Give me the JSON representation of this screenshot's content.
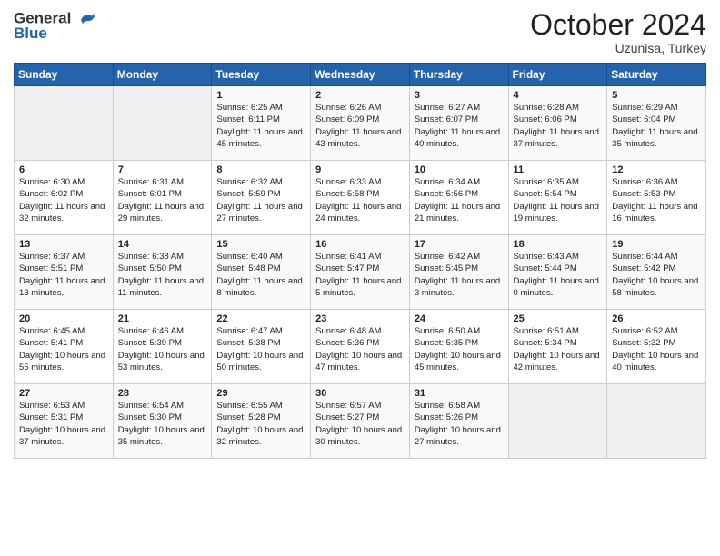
{
  "header": {
    "logo_line1": "General",
    "logo_line2": "Blue",
    "month": "October 2024",
    "location": "Uzunisa, Turkey"
  },
  "weekdays": [
    "Sunday",
    "Monday",
    "Tuesday",
    "Wednesday",
    "Thursday",
    "Friday",
    "Saturday"
  ],
  "weeks": [
    [
      {
        "day": "",
        "info": ""
      },
      {
        "day": "",
        "info": ""
      },
      {
        "day": "1",
        "info": "Sunrise: 6:25 AM\nSunset: 6:11 PM\nDaylight: 11 hours and 45 minutes."
      },
      {
        "day": "2",
        "info": "Sunrise: 6:26 AM\nSunset: 6:09 PM\nDaylight: 11 hours and 43 minutes."
      },
      {
        "day": "3",
        "info": "Sunrise: 6:27 AM\nSunset: 6:07 PM\nDaylight: 11 hours and 40 minutes."
      },
      {
        "day": "4",
        "info": "Sunrise: 6:28 AM\nSunset: 6:06 PM\nDaylight: 11 hours and 37 minutes."
      },
      {
        "day": "5",
        "info": "Sunrise: 6:29 AM\nSunset: 6:04 PM\nDaylight: 11 hours and 35 minutes."
      }
    ],
    [
      {
        "day": "6",
        "info": "Sunrise: 6:30 AM\nSunset: 6:02 PM\nDaylight: 11 hours and 32 minutes."
      },
      {
        "day": "7",
        "info": "Sunrise: 6:31 AM\nSunset: 6:01 PM\nDaylight: 11 hours and 29 minutes."
      },
      {
        "day": "8",
        "info": "Sunrise: 6:32 AM\nSunset: 5:59 PM\nDaylight: 11 hours and 27 minutes."
      },
      {
        "day": "9",
        "info": "Sunrise: 6:33 AM\nSunset: 5:58 PM\nDaylight: 11 hours and 24 minutes."
      },
      {
        "day": "10",
        "info": "Sunrise: 6:34 AM\nSunset: 5:56 PM\nDaylight: 11 hours and 21 minutes."
      },
      {
        "day": "11",
        "info": "Sunrise: 6:35 AM\nSunset: 5:54 PM\nDaylight: 11 hours and 19 minutes."
      },
      {
        "day": "12",
        "info": "Sunrise: 6:36 AM\nSunset: 5:53 PM\nDaylight: 11 hours and 16 minutes."
      }
    ],
    [
      {
        "day": "13",
        "info": "Sunrise: 6:37 AM\nSunset: 5:51 PM\nDaylight: 11 hours and 13 minutes."
      },
      {
        "day": "14",
        "info": "Sunrise: 6:38 AM\nSunset: 5:50 PM\nDaylight: 11 hours and 11 minutes."
      },
      {
        "day": "15",
        "info": "Sunrise: 6:40 AM\nSunset: 5:48 PM\nDaylight: 11 hours and 8 minutes."
      },
      {
        "day": "16",
        "info": "Sunrise: 6:41 AM\nSunset: 5:47 PM\nDaylight: 11 hours and 5 minutes."
      },
      {
        "day": "17",
        "info": "Sunrise: 6:42 AM\nSunset: 5:45 PM\nDaylight: 11 hours and 3 minutes."
      },
      {
        "day": "18",
        "info": "Sunrise: 6:43 AM\nSunset: 5:44 PM\nDaylight: 11 hours and 0 minutes."
      },
      {
        "day": "19",
        "info": "Sunrise: 6:44 AM\nSunset: 5:42 PM\nDaylight: 10 hours and 58 minutes."
      }
    ],
    [
      {
        "day": "20",
        "info": "Sunrise: 6:45 AM\nSunset: 5:41 PM\nDaylight: 10 hours and 55 minutes."
      },
      {
        "day": "21",
        "info": "Sunrise: 6:46 AM\nSunset: 5:39 PM\nDaylight: 10 hours and 53 minutes."
      },
      {
        "day": "22",
        "info": "Sunrise: 6:47 AM\nSunset: 5:38 PM\nDaylight: 10 hours and 50 minutes."
      },
      {
        "day": "23",
        "info": "Sunrise: 6:48 AM\nSunset: 5:36 PM\nDaylight: 10 hours and 47 minutes."
      },
      {
        "day": "24",
        "info": "Sunrise: 6:50 AM\nSunset: 5:35 PM\nDaylight: 10 hours and 45 minutes."
      },
      {
        "day": "25",
        "info": "Sunrise: 6:51 AM\nSunset: 5:34 PM\nDaylight: 10 hours and 42 minutes."
      },
      {
        "day": "26",
        "info": "Sunrise: 6:52 AM\nSunset: 5:32 PM\nDaylight: 10 hours and 40 minutes."
      }
    ],
    [
      {
        "day": "27",
        "info": "Sunrise: 6:53 AM\nSunset: 5:31 PM\nDaylight: 10 hours and 37 minutes."
      },
      {
        "day": "28",
        "info": "Sunrise: 6:54 AM\nSunset: 5:30 PM\nDaylight: 10 hours and 35 minutes."
      },
      {
        "day": "29",
        "info": "Sunrise: 6:55 AM\nSunset: 5:28 PM\nDaylight: 10 hours and 32 minutes."
      },
      {
        "day": "30",
        "info": "Sunrise: 6:57 AM\nSunset: 5:27 PM\nDaylight: 10 hours and 30 minutes."
      },
      {
        "day": "31",
        "info": "Sunrise: 6:58 AM\nSunset: 5:26 PM\nDaylight: 10 hours and 27 minutes."
      },
      {
        "day": "",
        "info": ""
      },
      {
        "day": "",
        "info": ""
      }
    ]
  ]
}
